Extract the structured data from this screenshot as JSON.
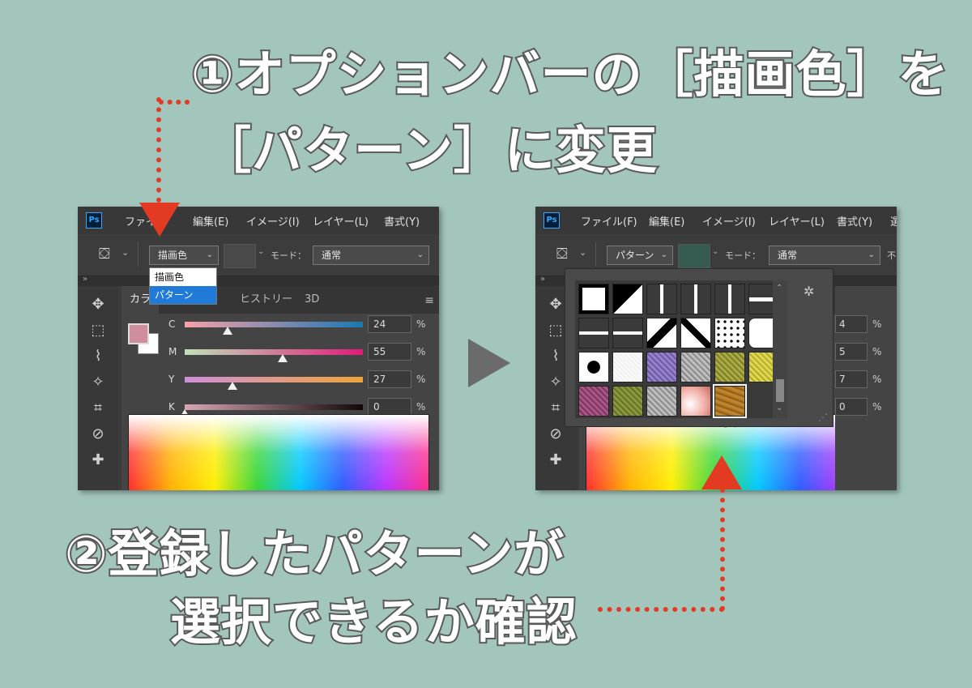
{
  "instructions": {
    "step1_line1": "①オプションバーの［描画色］を",
    "step1_line2": "［パターン］に変更",
    "step2_line1": "②登録したパターンが",
    "step2_line2": "選択できるか確認"
  },
  "app": {
    "logo": "Ps",
    "brand_color": "#31a8ff"
  },
  "menu": {
    "left": [
      "ファイ",
      "編集(E)",
      "イメージ(I)",
      "レイヤー(L)",
      "書式(Y)"
    ],
    "right": [
      "ファイル(F)",
      "編集(E)",
      "イメージ(I)",
      "レイヤー(L)",
      "書式(Y)",
      "選"
    ]
  },
  "options_left": {
    "fill_select": "描画色",
    "mode_label": "モード：",
    "mode_value": "通常",
    "dropdown": [
      "描画色",
      "パターン"
    ]
  },
  "options_right": {
    "fill_select": "パターン",
    "mode_label": "モード：",
    "mode_value": "通常",
    "extra": "不"
  },
  "panel": {
    "tabs": [
      "カラ",
      "ヒストリー",
      "3D"
    ],
    "sliders": [
      {
        "label": "C",
        "value": "24",
        "unit": "%",
        "level": 0.24,
        "gradient": "linear-gradient(to right,#f8a0a8,#1b78b5)"
      },
      {
        "label": "M",
        "value": "55",
        "unit": "%",
        "level": 0.55,
        "gradient": "linear-gradient(to right,#bfe0b8,#e21b7a)"
      },
      {
        "label": "Y",
        "value": "27",
        "unit": "%",
        "level": 0.27,
        "gradient": "linear-gradient(to right,#cf8fd8,#eea43a)"
      },
      {
        "label": "K",
        "value": "0",
        "unit": "%",
        "level": 0.0,
        "gradient": "linear-gradient(to right,#d7a6b2,#120808)"
      }
    ],
    "right_values": [
      "4",
      "5",
      "7",
      "0"
    ],
    "foreground_color": "#d08d9c"
  },
  "pattern_picker": {
    "selected_index": 22,
    "patterns": [
      "square-solid",
      "square-corner",
      "line-vertical",
      "line-vertical",
      "line-vertical",
      "line-horizontal-short",
      "line-horizontal",
      "line-horizontal",
      "diagonal-thick",
      "diagonal-thin",
      "dots-bw",
      "octagon",
      "octagon-small",
      "noise-white",
      "noise-purple",
      "noise-gray",
      "noise-olive",
      "noise-yellow",
      "noise-magenta",
      "noise-green",
      "noise-gray",
      "noise-pink",
      "wood-brown",
      "blank"
    ]
  }
}
